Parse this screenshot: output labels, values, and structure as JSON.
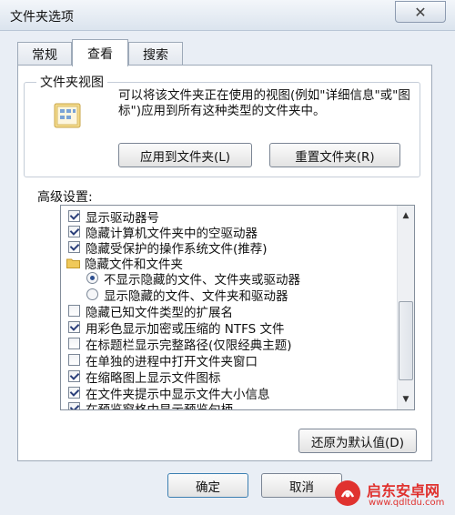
{
  "window": {
    "title": "文件夹选项",
    "close_glyph": "✕"
  },
  "tabs": [
    {
      "label": "常规"
    },
    {
      "label": "查看"
    },
    {
      "label": "搜索"
    }
  ],
  "folder_view": {
    "group_label": "文件夹视图",
    "description": "可以将该文件夹正在使用的视图(例如\"详细信息\"或\"图标\")应用到所有这种类型的文件夹中。",
    "apply_button": "应用到文件夹(L)",
    "reset_button": "重置文件夹(R)"
  },
  "advanced": {
    "label": "高级设置:",
    "items": [
      {
        "type": "checkbox",
        "checked": true,
        "label": "显示驱动器号"
      },
      {
        "type": "checkbox",
        "checked": true,
        "label": "隐藏计算机文件夹中的空驱动器"
      },
      {
        "type": "checkbox",
        "checked": true,
        "label": "隐藏受保护的操作系统文件(推荐)"
      },
      {
        "type": "folder",
        "label": "隐藏文件和文件夹"
      },
      {
        "type": "radio",
        "checked": true,
        "label": "不显示隐藏的文件、文件夹或驱动器"
      },
      {
        "type": "radio",
        "checked": false,
        "label": "显示隐藏的文件、文件夹和驱动器"
      },
      {
        "type": "checkbox",
        "checked": false,
        "label": "隐藏已知文件类型的扩展名"
      },
      {
        "type": "checkbox",
        "checked": true,
        "label": "用彩色显示加密或压缩的 NTFS 文件"
      },
      {
        "type": "checkbox",
        "checked": false,
        "label": "在标题栏显示完整路径(仅限经典主题)"
      },
      {
        "type": "checkbox",
        "checked": false,
        "label": "在单独的进程中打开文件夹窗口"
      },
      {
        "type": "checkbox",
        "checked": true,
        "label": "在缩略图上显示文件图标"
      },
      {
        "type": "checkbox",
        "checked": true,
        "label": "在文件夹提示中显示文件大小信息"
      },
      {
        "type": "checkbox",
        "checked": true,
        "label": "在预览窗格中显示预览句柄"
      }
    ],
    "restore_button": "还原为默认值(D)"
  },
  "footer": {
    "ok_button": "确定",
    "cancel_button": "取消"
  },
  "watermark": {
    "text": "启东安卓网",
    "url": "www.qdltdu.com"
  },
  "colors": {
    "accent": "#2d4f8f",
    "watermark_red": "#e0322f"
  }
}
